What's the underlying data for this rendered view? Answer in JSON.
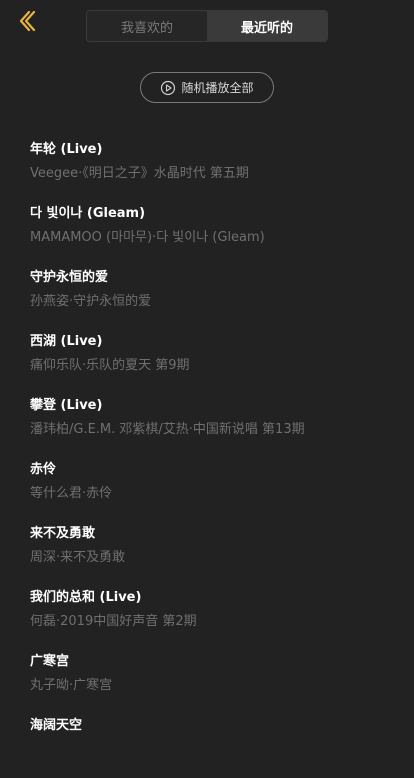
{
  "header": {
    "back_icon": "chevron-left-icon",
    "accent_color": "#e8b53b",
    "tabs": [
      {
        "label": "我喜欢的",
        "active": false
      },
      {
        "label": "最近听的",
        "active": true
      }
    ]
  },
  "shuffle": {
    "icon": "play-circle-icon",
    "label": "随机播放全部"
  },
  "songs": [
    {
      "title": "年轮 (Live)",
      "subtitle": "Veegee·《明日之子》水晶时代 第五期"
    },
    {
      "title": "다 빛이나 (Gleam)",
      "subtitle": "MAMAMOO (마마무)·다 빛이나 (Gleam)"
    },
    {
      "title": "守护永恒的爱",
      "subtitle": "孙燕姿·守护永恒的爱"
    },
    {
      "title": "西湖 (Live)",
      "subtitle": "痛仰乐队·乐队的夏天 第9期"
    },
    {
      "title": "攀登 (Live)",
      "subtitle": "潘玮柏/G.E.M. 邓紫棋/艾热·中国新说唱 第13期"
    },
    {
      "title": "赤伶",
      "subtitle": "等什么君·赤伶"
    },
    {
      "title": "来不及勇敢",
      "subtitle": "周深·来不及勇敢"
    },
    {
      "title": "我们的总和 (Live)",
      "subtitle": "何磊·2019中国好声音 第2期"
    },
    {
      "title": "广寒宫",
      "subtitle": "丸子呦·广寒宫"
    },
    {
      "title": "海阔天空",
      "subtitle": ""
    }
  ]
}
